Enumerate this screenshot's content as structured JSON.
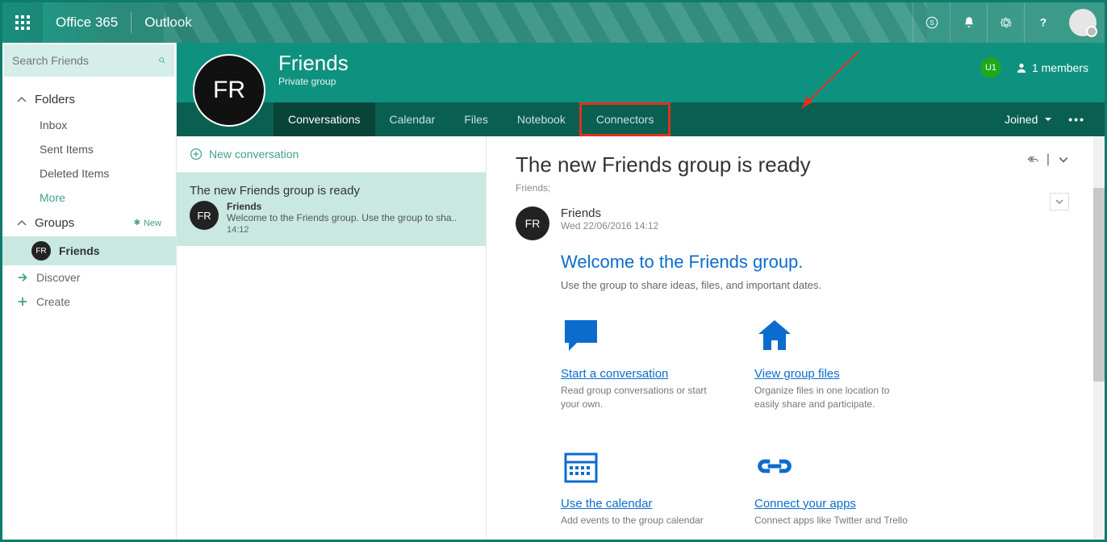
{
  "suite": {
    "brand": "Office 365",
    "app": "Outlook"
  },
  "search": {
    "placeholder": "Search Friends"
  },
  "nav": {
    "folders_label": "Folders",
    "folders": [
      "Inbox",
      "Sent Items",
      "Deleted Items"
    ],
    "more": "More",
    "groups_label": "Groups",
    "new_label": "New",
    "group_name": "Friends",
    "group_initials": "FR",
    "discover": "Discover",
    "create": "Create"
  },
  "group_header": {
    "initials": "FR",
    "title": "Friends",
    "subtitle": "Private group",
    "user_badge": "U1",
    "members": "1 members",
    "joined": "Joined",
    "tabs": [
      "Conversations",
      "Calendar",
      "Files",
      "Notebook",
      "Connectors"
    ]
  },
  "list": {
    "new_conv": "New conversation",
    "item": {
      "subject": "The new Friends group is ready",
      "from": "Friends",
      "preview": "Welcome to the Friends group. Use the group to sha..",
      "time": "14:12",
      "initials": "FR"
    }
  },
  "reading": {
    "title": "The new Friends group is ready",
    "to": "Friends;",
    "from": "Friends",
    "from_initials": "FR",
    "date": "Wed 22/06/2016 14:12",
    "welcome": "Welcome to the Friends group.",
    "desc": "Use the group to share ideas, files, and important dates.",
    "cards": {
      "conv": {
        "title": "Start a conversation",
        "desc": "Read group conversations or start your own."
      },
      "files": {
        "title": "View group files",
        "desc": "Organize files in one location to easily share and participate."
      },
      "cal": {
        "title": "Use the calendar",
        "desc": "Add events to the group calendar"
      },
      "apps": {
        "title": "Connect your apps",
        "desc": "Connect apps like Twitter and Trello"
      }
    }
  }
}
